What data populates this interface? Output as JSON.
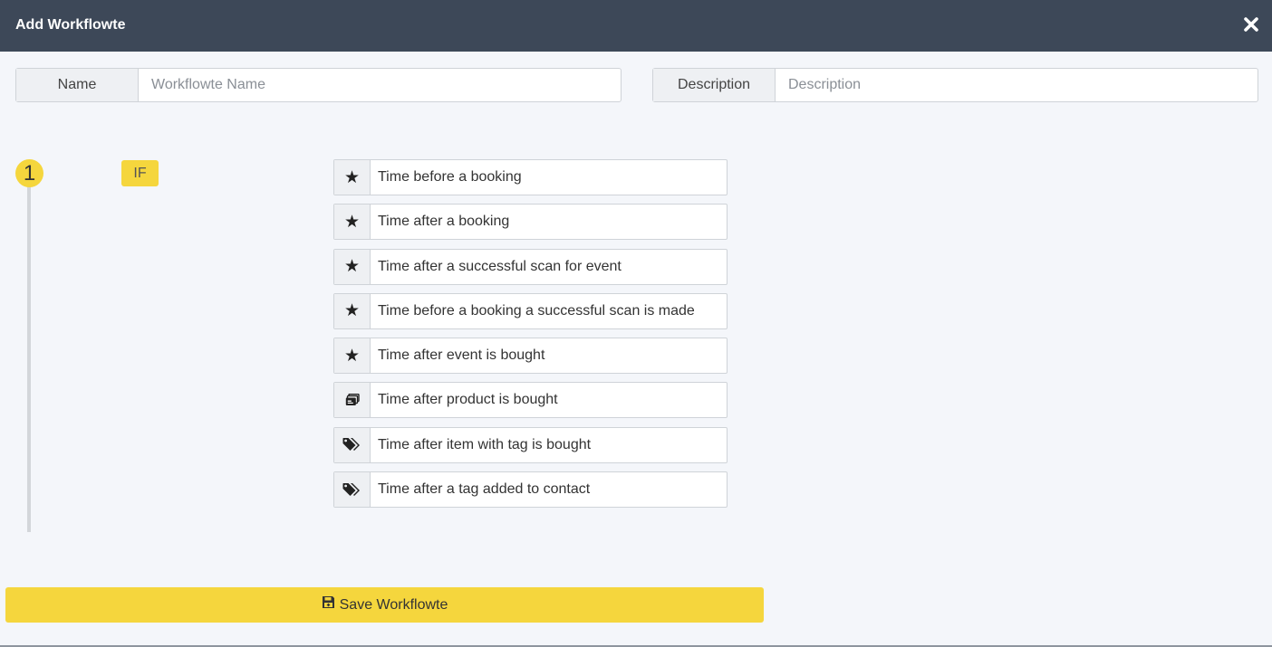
{
  "dialog": {
    "title": "Add Workflowte"
  },
  "form": {
    "name_label": "Name",
    "name_placeholder": "Workflowte Name",
    "name_value": "",
    "description_label": "Description",
    "description_placeholder": "Description",
    "description_value": ""
  },
  "step": {
    "number": "1",
    "condition_label": "IF",
    "triggers": [
      {
        "icon": "star-icon",
        "label": "Time before a booking"
      },
      {
        "icon": "star-icon",
        "label": "Time after a booking"
      },
      {
        "icon": "star-icon",
        "label": "Time after a successful scan for event"
      },
      {
        "icon": "star-icon",
        "label": "Time before a booking a successful scan is made"
      },
      {
        "icon": "star-icon",
        "label": "Time after event is bought"
      },
      {
        "icon": "product-icon",
        "label": "Time after product is bought"
      },
      {
        "icon": "tags-icon",
        "label": "Time after item with tag is bought"
      },
      {
        "icon": "tags-icon",
        "label": "Time after a tag added to contact"
      }
    ]
  },
  "actions": {
    "save_label": "Save Workflowte"
  },
  "colors": {
    "header_bg": "#3d4858",
    "accent": "#f5d63d",
    "page_bg": "#f4f6fa"
  }
}
